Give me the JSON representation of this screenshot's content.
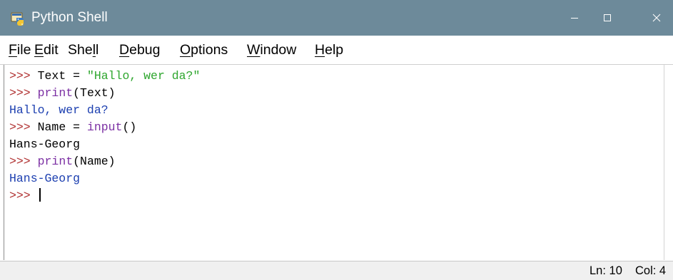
{
  "window": {
    "title": "Python  Shell",
    "icon": "python-shell-icon"
  },
  "controls": {
    "minimize_icon": "minimize-icon",
    "maximize_icon": "maximize-icon",
    "close_icon": "close-icon"
  },
  "menu": {
    "items": [
      {
        "mnemonic": "F",
        "rest": "ile"
      },
      {
        "mnemonic": "E",
        "rest": "dit"
      },
      {
        "pre": "She",
        "mnemonic": "l",
        "rest": "l"
      },
      {
        "mnemonic": "D",
        "rest": "ebug"
      },
      {
        "mnemonic": "O",
        "rest": "ptions"
      },
      {
        "mnemonic": "W",
        "rest": "indow"
      },
      {
        "mnemonic": "H",
        "rest": "elp"
      }
    ]
  },
  "shell": {
    "prompt": ">>>",
    "lines": [
      {
        "kind": "input",
        "parts": [
          "Text = ",
          "\"Hallo, wer da?\""
        ]
      },
      {
        "kind": "input",
        "parts": [
          "print",
          "(Text)"
        ]
      },
      {
        "kind": "output",
        "text": "Hallo, wer da?"
      },
      {
        "kind": "input",
        "parts": [
          "Name = ",
          "input",
          "()"
        ]
      },
      {
        "kind": "stdin",
        "text": "Hans-Georg"
      },
      {
        "kind": "input",
        "parts": [
          "print",
          "(Name)"
        ]
      },
      {
        "kind": "output",
        "text": "Hans-Georg"
      },
      {
        "kind": "input",
        "parts": [
          ""
        ]
      }
    ]
  },
  "status": {
    "ln": "Ln: 10",
    "col": "Col: 4"
  },
  "colors": {
    "titlebar": "#6d8a9a",
    "prompt": "#b03030",
    "builtin": "#7b2fa3",
    "string": "#2ea62e",
    "output": "#1c3fb0"
  }
}
